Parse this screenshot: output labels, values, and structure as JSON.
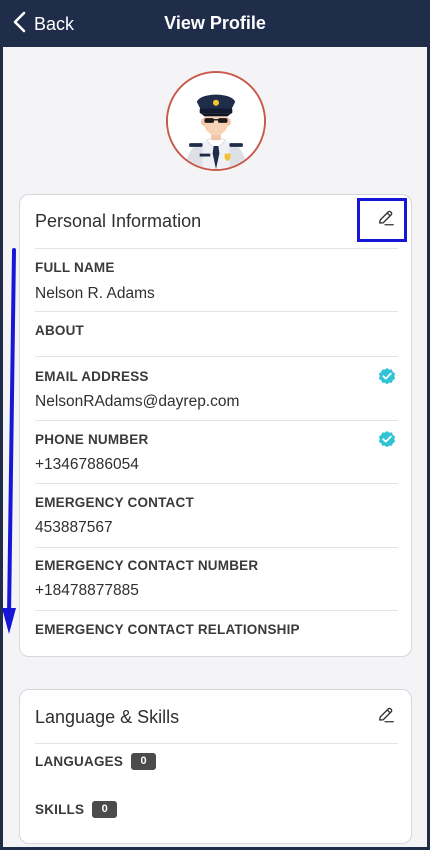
{
  "header": {
    "back_label": "Back",
    "title": "View Profile"
  },
  "personal": {
    "title": "Personal Information",
    "fields": [
      {
        "label": "FULL NAME",
        "value": "Nelson R. Adams"
      },
      {
        "label": "ABOUT",
        "value": ""
      },
      {
        "label": "EMAIL ADDRESS",
        "value": "NelsonRAdams@dayrep.com",
        "verified": true
      },
      {
        "label": "PHONE NUMBER",
        "value": "+13467886054",
        "verified": true
      },
      {
        "label": "EMERGENCY CONTACT",
        "value": "453887567"
      },
      {
        "label": "EMERGENCY CONTACT NUMBER",
        "value": "+18478877885"
      },
      {
        "label": "EMERGENCY CONTACT RELATIONSHIP",
        "value": ""
      }
    ]
  },
  "language_skills": {
    "title": "Language & Skills",
    "languages_label": "LANGUAGES",
    "languages_count": "0",
    "skills_label": "SKILLS",
    "skills_count": "0"
  },
  "colors": {
    "header_bg": "#1f2c4a",
    "verified": "#2ec4d6",
    "highlight": "#1616d6"
  },
  "icons": [
    "back-chevron-icon",
    "pencil-icon",
    "verified-badge-icon",
    "avatar-officer-icon",
    "scroll-arrow-icon"
  ]
}
